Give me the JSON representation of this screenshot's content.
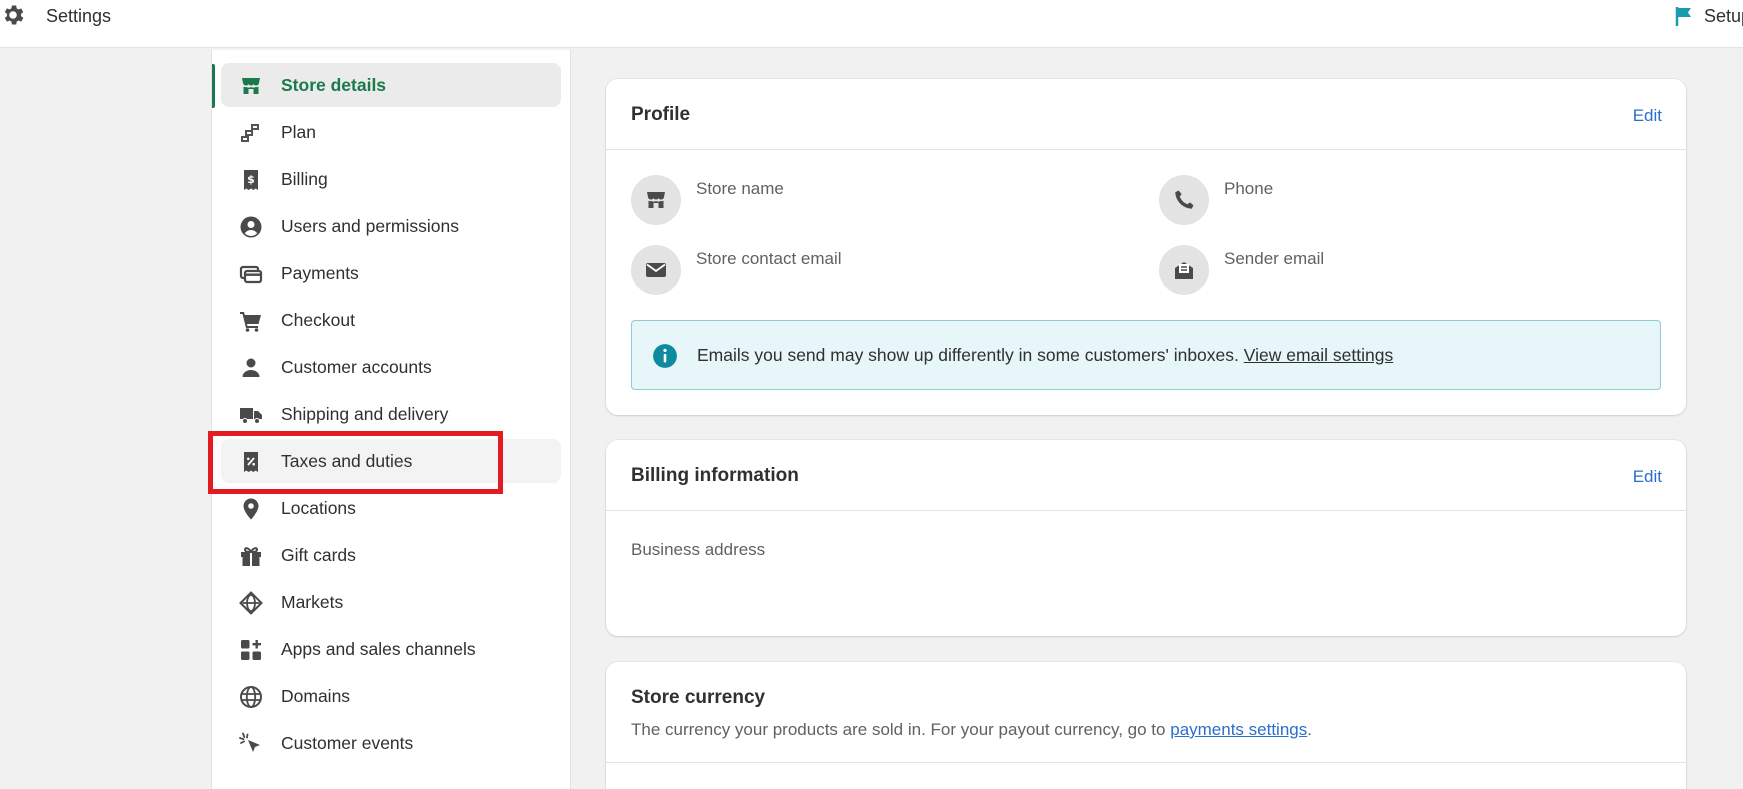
{
  "header": {
    "title": "Settings",
    "setup_label": "Setup"
  },
  "sidebar": {
    "items": [
      {
        "label": "Store details",
        "icon": "store-icon"
      },
      {
        "label": "Plan",
        "icon": "plan-icon"
      },
      {
        "label": "Billing",
        "icon": "billing-icon"
      },
      {
        "label": "Users and permissions",
        "icon": "user-circle-icon"
      },
      {
        "label": "Payments",
        "icon": "payments-icon"
      },
      {
        "label": "Checkout",
        "icon": "cart-icon"
      },
      {
        "label": "Customer accounts",
        "icon": "person-icon"
      },
      {
        "label": "Shipping and delivery",
        "icon": "truck-icon"
      },
      {
        "label": "Taxes and duties",
        "icon": "tax-receipt-icon"
      },
      {
        "label": "Locations",
        "icon": "location-pin-icon"
      },
      {
        "label": "Gift cards",
        "icon": "gift-icon"
      },
      {
        "label": "Markets",
        "icon": "globe-markets-icon"
      },
      {
        "label": "Apps and sales channels",
        "icon": "apps-icon"
      },
      {
        "label": "Domains",
        "icon": "globe-icon"
      },
      {
        "label": "Customer events",
        "icon": "cursor-click-icon"
      }
    ],
    "active_item": "Store details"
  },
  "profile": {
    "title": "Profile",
    "edit_label": "Edit",
    "store_name_label": "Store name",
    "phone_label": "Phone",
    "contact_email_label": "Store contact email",
    "sender_email_label": "Sender email",
    "banner_text": "Emails you send may show up differently in some customers' inboxes.",
    "banner_link": "View email settings"
  },
  "billing": {
    "title": "Billing information",
    "edit_label": "Edit",
    "business_address_label": "Business address"
  },
  "currency": {
    "title": "Store currency",
    "description": "The currency your products are sold in. For your payout currency, go to",
    "link": "payments settings",
    "period": "."
  },
  "colors": {
    "accent_green": "#1a7a4c",
    "link_blue": "#2c6ecb",
    "highlight_red": "#e31b23",
    "banner_bg": "#e7f6f8",
    "setup_flag": "#1a9bb0"
  }
}
